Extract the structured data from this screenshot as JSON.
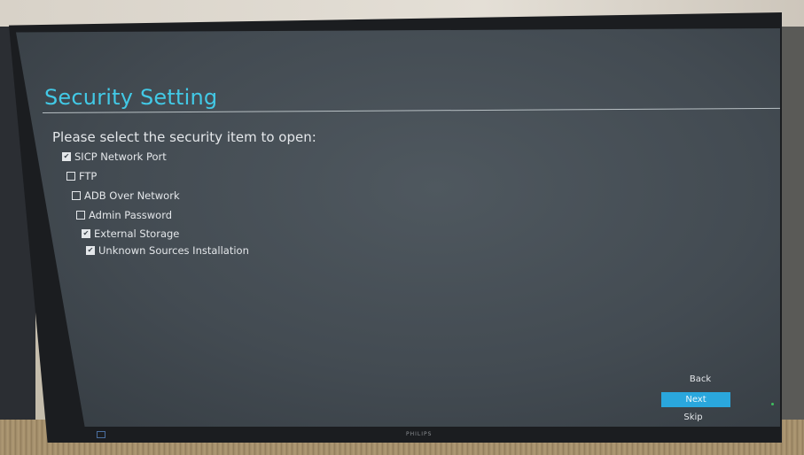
{
  "page": {
    "title": "Security Setting",
    "prompt": "Please select the security item to open:"
  },
  "options": [
    {
      "label": "SICP Network Port",
      "checked": true
    },
    {
      "label": "FTP",
      "checked": false
    },
    {
      "label": "ADB Over Network",
      "checked": false
    },
    {
      "label": "Admin Password",
      "checked": false
    },
    {
      "label": "External Storage",
      "checked": true
    },
    {
      "label": "Unknown Sources Installation",
      "checked": true
    }
  ],
  "buttons": {
    "back": "Back",
    "next": "Next",
    "skip": "Skip"
  },
  "monitor": {
    "brand": "PHILIPS"
  },
  "colors": {
    "title": "#42c9e6",
    "accent": "#2aa7dd",
    "screen": "#434b52"
  }
}
